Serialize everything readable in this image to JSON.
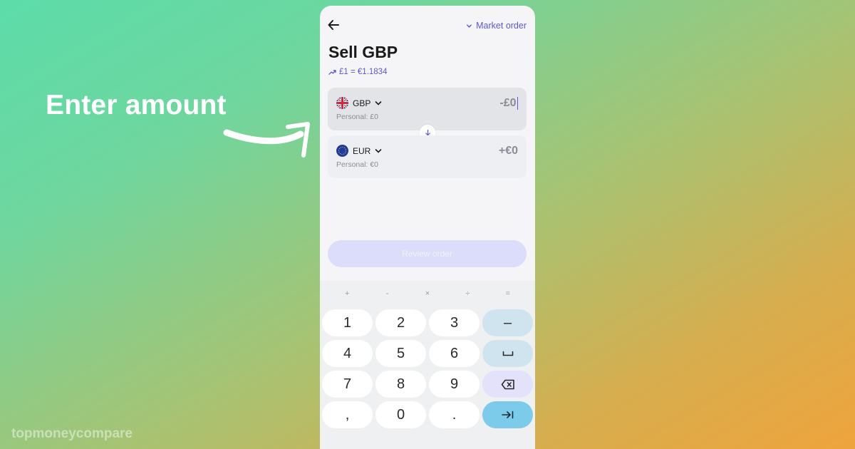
{
  "overlay": {
    "headline": "Enter amount",
    "watermark": "topmoneycompare"
  },
  "app": {
    "topbar": {
      "back_icon": "arrow-left-icon",
      "market_order_label": "Market order"
    },
    "title": "Sell GBP",
    "rate": "£1 = €1.1834",
    "sell": {
      "currency": "GBP",
      "balance": "Personal: £0",
      "amount": "-£0"
    },
    "buy": {
      "currency": "EUR",
      "balance": "Personal: €0",
      "amount": "+€0"
    },
    "review_button": "Review order",
    "keyboard": {
      "ops": [
        "+",
        "-",
        "×",
        "÷",
        "="
      ],
      "keys": [
        {
          "label": "1",
          "type": "digit"
        },
        {
          "label": "2",
          "type": "digit"
        },
        {
          "label": "3",
          "type": "digit"
        },
        {
          "label": "–",
          "type": "util"
        },
        {
          "label": "4",
          "type": "digit"
        },
        {
          "label": "5",
          "type": "digit"
        },
        {
          "label": "6",
          "type": "digit"
        },
        {
          "label": "␣",
          "type": "util"
        },
        {
          "label": "7",
          "type": "digit"
        },
        {
          "label": "8",
          "type": "digit"
        },
        {
          "label": "9",
          "type": "digit"
        },
        {
          "label": "",
          "type": "del"
        },
        {
          "label": ",",
          "type": "digit"
        },
        {
          "label": "0",
          "type": "digit"
        },
        {
          "label": ".",
          "type": "digit"
        },
        {
          "label": "→|",
          "type": "enter"
        }
      ]
    }
  },
  "colors": {
    "accent": "#5b57d6",
    "review_button_bg": "#dcdcfb",
    "enter_key_bg": "#7dcbea",
    "util_key_bg": "#cfe4ee",
    "delete_key_bg": "#e4e1fa"
  }
}
